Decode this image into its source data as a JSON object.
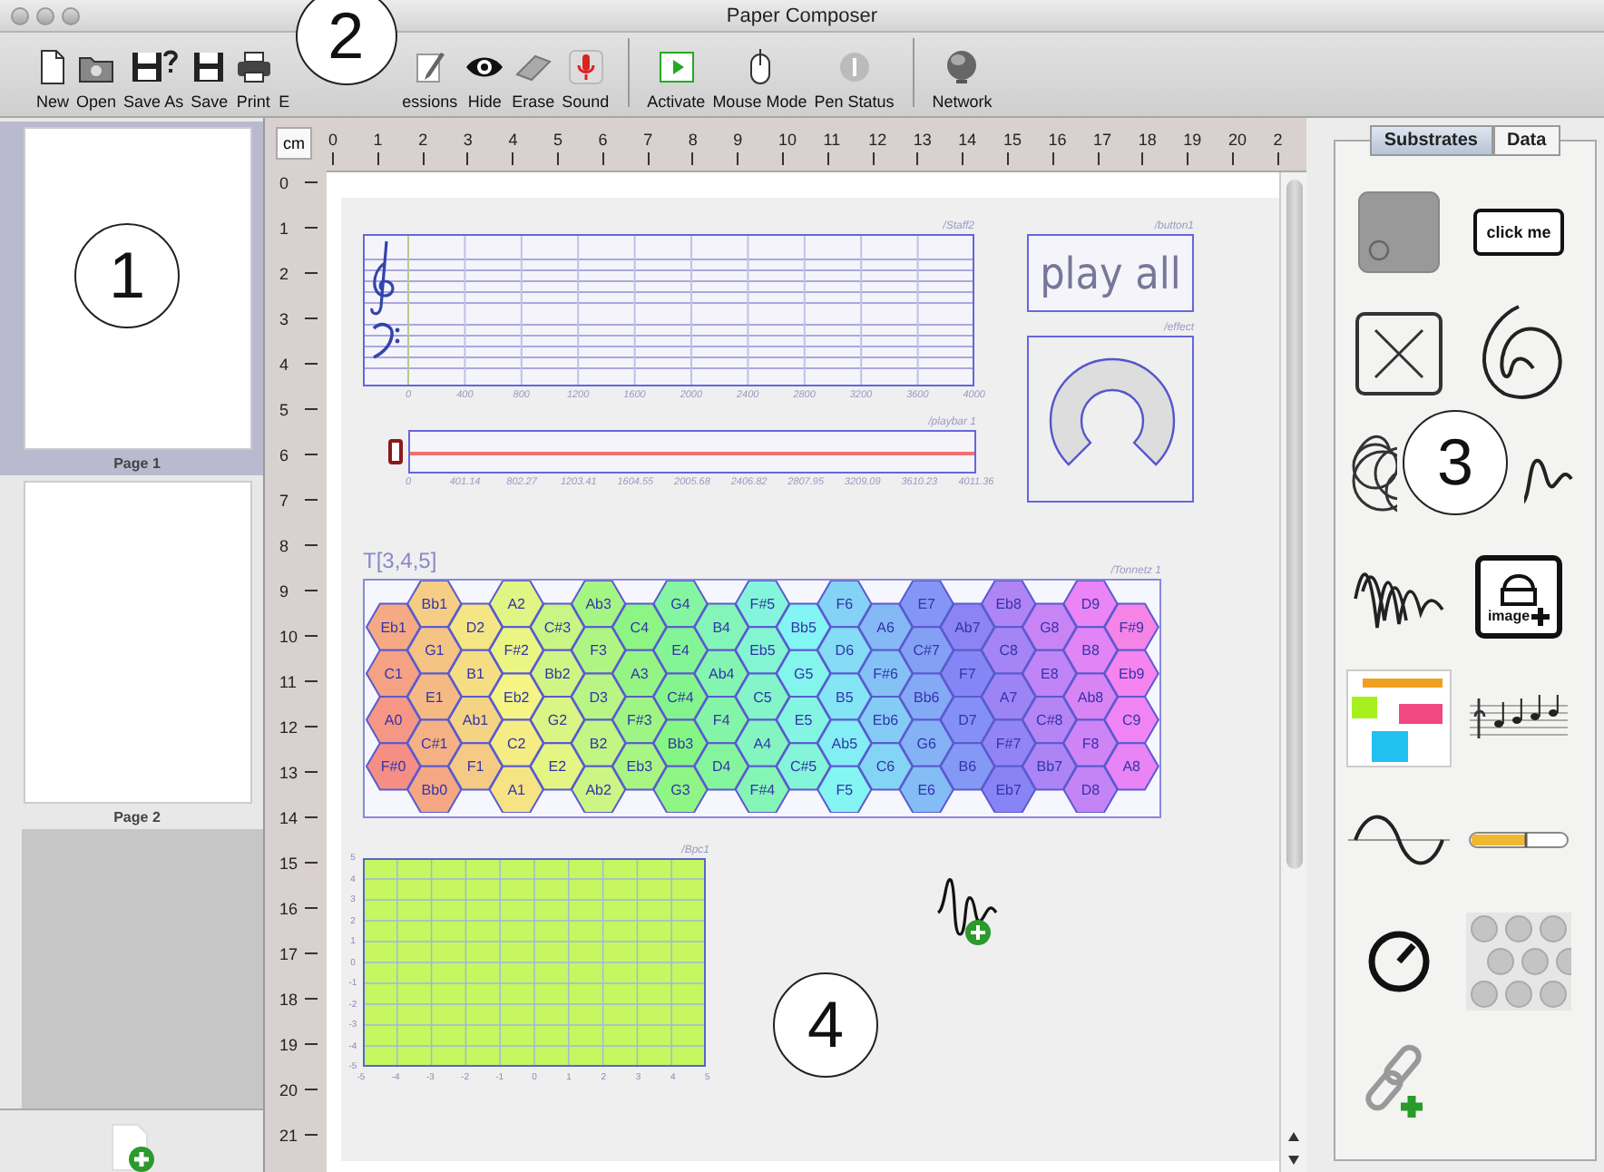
{
  "window": {
    "title": "Paper Composer"
  },
  "toolbar": {
    "groups": [
      {
        "items": [
          {
            "label": "New"
          },
          {
            "label": "Open"
          },
          {
            "label": "Save As"
          },
          {
            "label": "Save"
          },
          {
            "label": "Print"
          },
          {
            "label": "E"
          },
          {
            "label": "essions"
          },
          {
            "label": "Hide"
          },
          {
            "label": "Erase"
          },
          {
            "label": "Sound"
          }
        ]
      },
      {
        "items": [
          {
            "label": "Activate"
          },
          {
            "label": "Mouse Mode"
          },
          {
            "label": "Pen Status"
          }
        ]
      },
      {
        "items": [
          {
            "label": "Network"
          }
        ]
      }
    ]
  },
  "pages": [
    {
      "label": "Page 1",
      "selected": true
    },
    {
      "label": "Page 2",
      "selected": false
    }
  ],
  "ruler": {
    "unit": "cm",
    "x_marks": [
      "0",
      "1",
      "2",
      "3",
      "4",
      "5",
      "6",
      "7",
      "8",
      "9",
      "10",
      "11",
      "12",
      "13",
      "14",
      "15",
      "16",
      "17",
      "18",
      "19",
      "20",
      "2"
    ],
    "y_marks": [
      "0",
      "1",
      "2",
      "3",
      "4",
      "5",
      "6",
      "7",
      "8",
      "9",
      "10",
      "11",
      "12",
      "13",
      "14",
      "15",
      "16",
      "17",
      "18",
      "19",
      "20",
      "21"
    ]
  },
  "canvas": {
    "staff": {
      "name": "/Staff2",
      "axis": [
        "0",
        "400",
        "800",
        "1200",
        "1600",
        "2000",
        "2400",
        "2800",
        "3200",
        "3600",
        "4000"
      ]
    },
    "playbar": {
      "name": "/playbar 1",
      "level": 0,
      "axis": [
        "0",
        "401.14",
        "802.27",
        "1203.41",
        "1604.55",
        "2005.68",
        "2406.82",
        "2807.95",
        "3209.09",
        "3610.23",
        "4011.36"
      ]
    },
    "button": {
      "name": "/button1",
      "label": "play all"
    },
    "knob": {
      "name": "/effect"
    },
    "tonnetz": {
      "title": "T[3,4,5]",
      "name": "/Tonnetz 1",
      "columns": [
        [
          "Eb1",
          "C1",
          "A0",
          "F#0"
        ],
        [
          "Bb1",
          "G1",
          "E1",
          "C#1",
          "Bb0"
        ],
        [
          "D2",
          "B1",
          "Ab1",
          "F1"
        ],
        [
          "A2",
          "F#2",
          "Eb2",
          "C2",
          "A1"
        ],
        [
          "C#3",
          "Bb2",
          "G2",
          "E2"
        ],
        [
          "Ab3",
          "F3",
          "D3",
          "B2",
          "Ab2"
        ],
        [
          "C4",
          "A3",
          "F#3",
          "Eb3"
        ],
        [
          "G4",
          "E4",
          "C#4",
          "Bb3",
          "G3"
        ],
        [
          "B4",
          "Ab4",
          "F4",
          "D4"
        ],
        [
          "F#5",
          "Eb5",
          "C5",
          "A4",
          "F#4"
        ],
        [
          "Bb5",
          "G5",
          "E5",
          "C#5"
        ],
        [
          "F6",
          "D6",
          "B5",
          "Ab5",
          "F5"
        ],
        [
          "A6",
          "F#6",
          "Eb6",
          "C6"
        ],
        [
          "E7",
          "C#7",
          "Bb6",
          "G6",
          "E6"
        ],
        [
          "Ab7",
          "F7",
          "D7",
          "B6"
        ],
        [
          "Eb8",
          "C8",
          "A7",
          "F#7",
          "Eb7"
        ],
        [
          "G8",
          "E8",
          "C#8",
          "Bb7"
        ],
        [
          "D9",
          "B8",
          "Ab8",
          "F8",
          "D8"
        ],
        [
          "F#9",
          "Eb9",
          "C9",
          "A8"
        ]
      ]
    },
    "xy_pad": {
      "name": "/Bpc1",
      "y_ticks": [
        "5",
        "4",
        "3",
        "2",
        "1",
        "0",
        "-1",
        "-2",
        "-3",
        "-4",
        "-5"
      ],
      "x_ticks": [
        "-5",
        "-4",
        "-3",
        "-2",
        "-1",
        "0",
        "1",
        "2",
        "3",
        "4",
        "5"
      ]
    }
  },
  "palette": {
    "tabs": [
      {
        "label": "Substrates",
        "selected": true
      },
      {
        "label": "Data",
        "selected": false
      }
    ],
    "items": [
      {
        "kind": "button"
      },
      {
        "kind": "click",
        "label": "click me"
      },
      {
        "kind": "xbox"
      },
      {
        "kind": "spiral"
      },
      {
        "kind": "scribble"
      },
      {
        "kind": "wave"
      },
      {
        "kind": "noise"
      },
      {
        "kind": "image",
        "label": "image"
      },
      {
        "kind": "layout"
      },
      {
        "kind": "score"
      },
      {
        "kind": "sine"
      },
      {
        "kind": "slider"
      },
      {
        "kind": "knob"
      },
      {
        "kind": "hexgrid"
      },
      {
        "kind": "link"
      }
    ]
  },
  "callouts": [
    "1",
    "2",
    "3",
    "4"
  ]
}
